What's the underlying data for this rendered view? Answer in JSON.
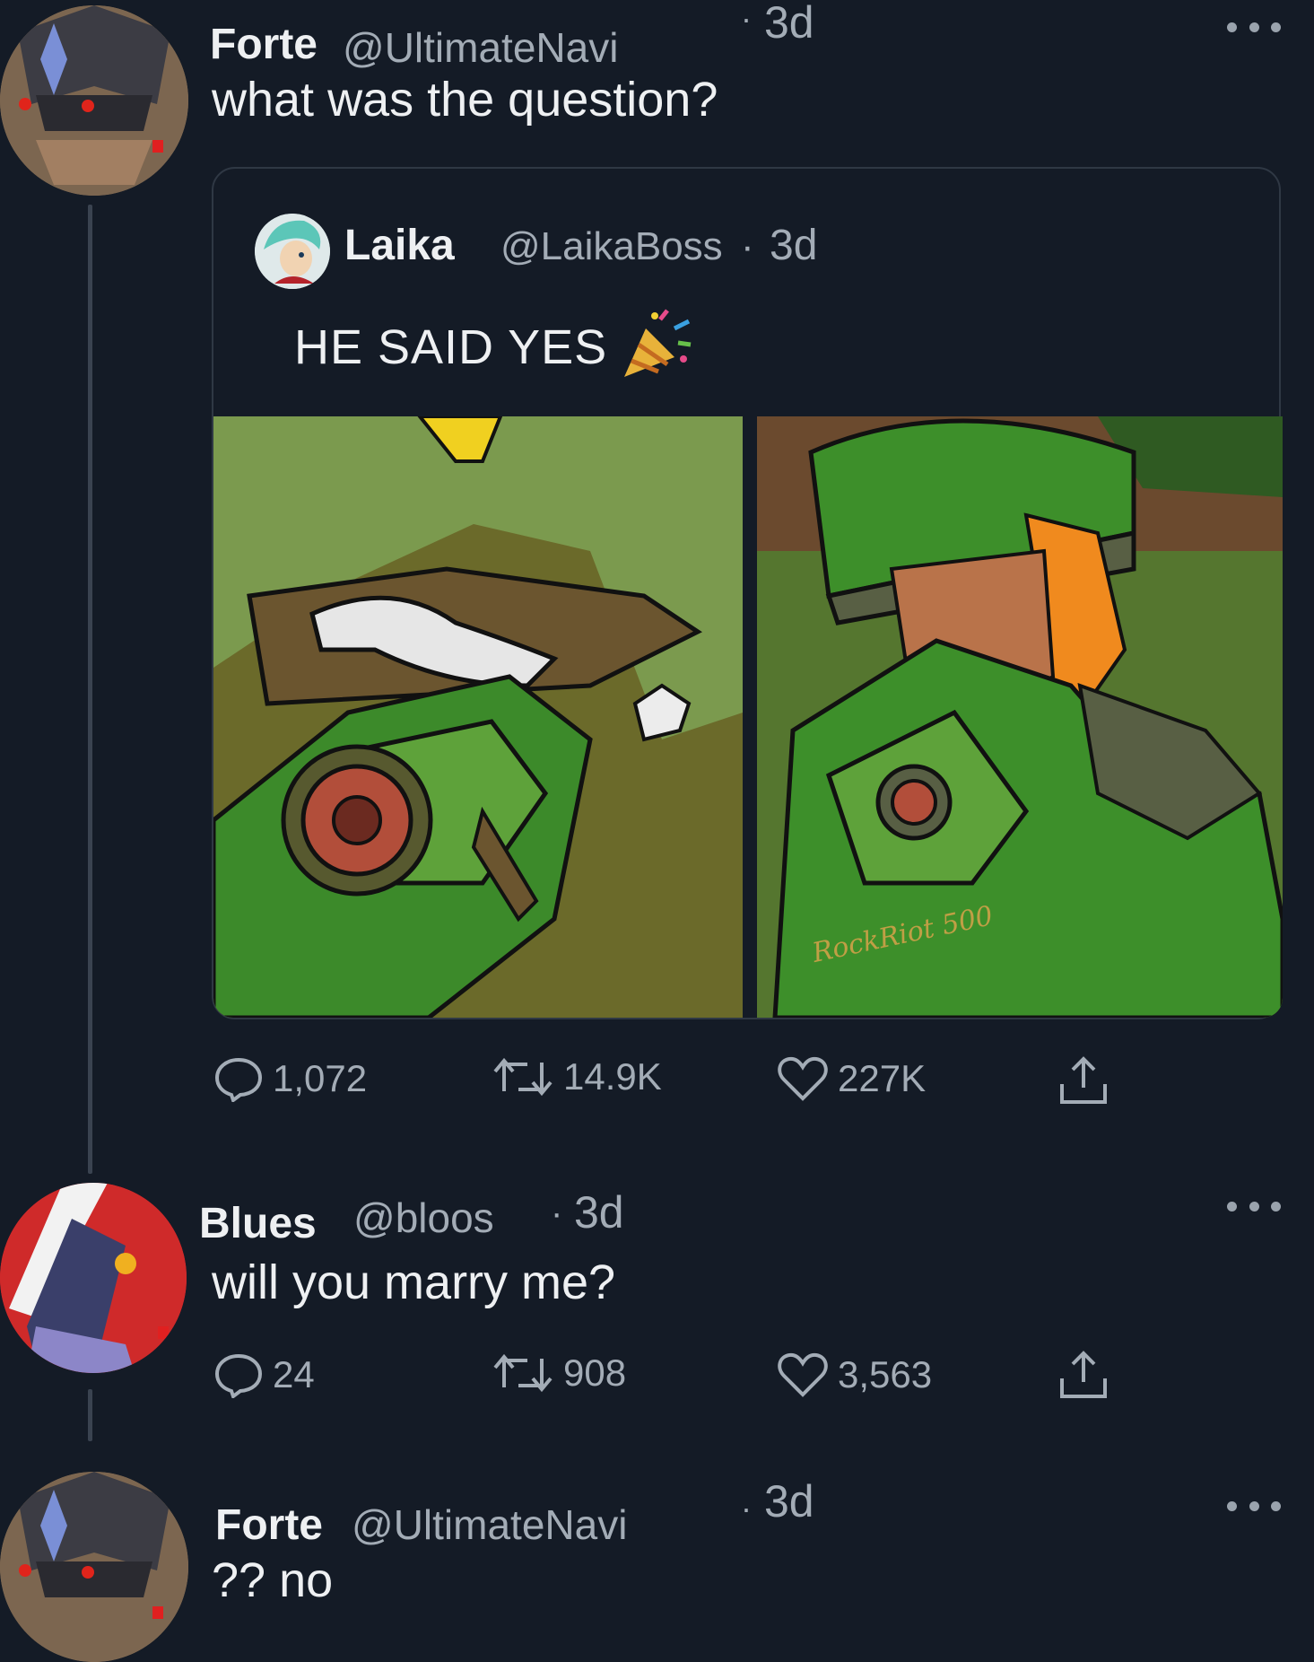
{
  "colors": {
    "background": "#141b26",
    "text_primary": "#eef0f2",
    "text_secondary": "#a3acb6",
    "thread_line": "#3a4350"
  },
  "tweets": [
    {
      "author": "Forte",
      "handle": "@UltimateNavi",
      "dot": "·",
      "time": "3d",
      "text": "what was the question?",
      "avatar_icon": "forte-avatar",
      "quoted": {
        "author": "Laika",
        "handle": "@LaikaBoss",
        "dot": "·",
        "time": "3d",
        "text": "HE SAID YES",
        "emoji_icon": "party-popper-icon",
        "avatar_icon": "laika-avatar",
        "images": [
          "proposal-drawing-left",
          "proposal-drawing-right"
        ],
        "watermark": "RockRiot 500",
        "actions": {
          "replies": "1,072",
          "retweets": "14.9K",
          "likes": "227K"
        }
      }
    },
    {
      "author": "Blues",
      "handle": "@bloos",
      "dot": "·",
      "time": "3d",
      "text": "will you marry me?",
      "avatar_icon": "blues-avatar",
      "actions": {
        "replies": "24",
        "retweets": "908",
        "likes": "3,563"
      }
    },
    {
      "author": "Forte",
      "handle": "@UltimateNavi",
      "dot": "·",
      "time": "3d",
      "text": "?? no",
      "avatar_icon": "forte-avatar"
    }
  ]
}
